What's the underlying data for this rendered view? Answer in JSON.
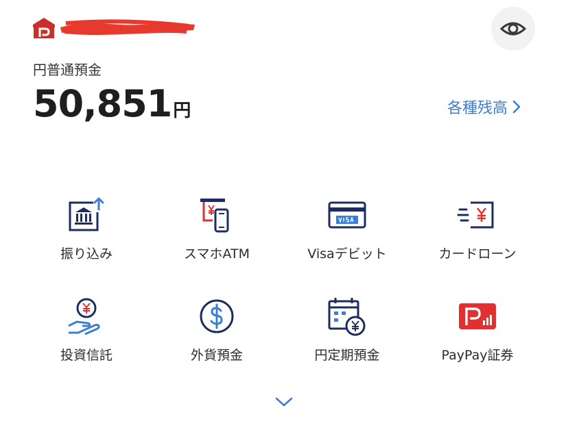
{
  "header": {
    "account_name_redacted": true
  },
  "account": {
    "type": "円普通預金",
    "balance": "50,851",
    "currency_unit": "円",
    "all_balances_link": "各種残高"
  },
  "menu": [
    {
      "label": "振り込み",
      "icon": "bank-transfer-icon"
    },
    {
      "label": "スマホATM",
      "icon": "smartphone-atm-icon"
    },
    {
      "label": "Visaデビット",
      "icon": "visa-card-icon"
    },
    {
      "label": "カードローン",
      "icon": "card-loan-icon"
    },
    {
      "label": "投資信託",
      "icon": "investment-trust-icon"
    },
    {
      "label": "外貨預金",
      "icon": "foreign-currency-icon"
    },
    {
      "label": "円定期預金",
      "icon": "yen-time-deposit-icon"
    },
    {
      "label": "PayPay証券",
      "icon": "paypay-securities-icon"
    }
  ],
  "colors": {
    "navy": "#1d2c5e",
    "accent_blue": "#3a7fd3",
    "red": "#e0302f",
    "redact": "#e8392f"
  }
}
